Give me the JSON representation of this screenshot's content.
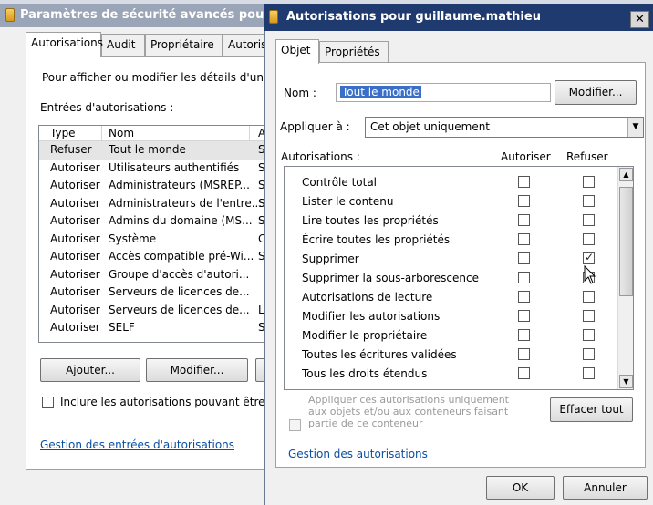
{
  "back_window": {
    "title": "Paramètres de sécurité avancés pour",
    "tabs": [
      "Autorisations",
      "Audit",
      "Propriétaire",
      "Autorisa"
    ],
    "intro": "Pour afficher ou modifier les détails d'une au",
    "entries_label": "Entrées d'autorisations :",
    "columns": [
      "Type",
      "Nom",
      "A"
    ],
    "rows": [
      {
        "type": "Refuser",
        "name": "Tout le monde",
        "extra": "S"
      },
      {
        "type": "Autoriser",
        "name": "Utilisateurs authentifiés",
        "extra": "S"
      },
      {
        "type": "Autoriser",
        "name": "Administrateurs (MSREP...",
        "extra": "S"
      },
      {
        "type": "Autoriser",
        "name": "Administrateurs de l'entre...",
        "extra": "S"
      },
      {
        "type": "Autoriser",
        "name": "Admins du domaine (MS...",
        "extra": "S"
      },
      {
        "type": "Autoriser",
        "name": "Système",
        "extra": "C"
      },
      {
        "type": "Autoriser",
        "name": "Accès compatible pré-Wi...",
        "extra": "S"
      },
      {
        "type": "Autoriser",
        "name": "Groupe d'accès d'autori...",
        "extra": ""
      },
      {
        "type": "Autoriser",
        "name": "Serveurs de licences de...",
        "extra": ""
      },
      {
        "type": "Autoriser",
        "name": "Serveurs de licences de...",
        "extra": "L"
      },
      {
        "type": "Autoriser",
        "name": "SELF",
        "extra": "S"
      }
    ],
    "add_button": "Ajouter...",
    "modify_button": "Modifier...",
    "include_label": "Inclure les autorisations pouvant être hé",
    "manage_link": "Gestion des entrées d'autorisations"
  },
  "dialog": {
    "title": "Autorisations pour guillaume.mathieu",
    "close": "✕",
    "tabs": [
      "Objet",
      "Propriétés"
    ],
    "name_label": "Nom :",
    "name_value": "Tout le monde",
    "modify_button": "Modifier...",
    "apply_label": "Appliquer à :",
    "apply_value": "Cet objet uniquement",
    "permissions_label": "Autorisations :",
    "allow_header": "Autoriser",
    "deny_header": "Refuser",
    "permissions": [
      {
        "label": "Contrôle total",
        "allow": false,
        "deny": false
      },
      {
        "label": "Lister le contenu",
        "allow": false,
        "deny": false
      },
      {
        "label": "Lire toutes les propriétés",
        "allow": false,
        "deny": false
      },
      {
        "label": "Écrire toutes les propriétés",
        "allow": false,
        "deny": false
      },
      {
        "label": "Supprimer",
        "allow": false,
        "deny": true
      },
      {
        "label": "Supprimer la sous-arborescence",
        "allow": false,
        "deny": false
      },
      {
        "label": "Autorisations de lecture",
        "allow": false,
        "deny": false
      },
      {
        "label": "Modifier les autorisations",
        "allow": false,
        "deny": false
      },
      {
        "label": "Modifier le propriétaire",
        "allow": false,
        "deny": false
      },
      {
        "label": "Toutes les écritures validées",
        "allow": false,
        "deny": false
      },
      {
        "label": "Tous les droits étendus",
        "allow": false,
        "deny": false
      }
    ],
    "apply_only_line1": "Appliquer ces autorisations uniquement",
    "apply_only_line2": "aux objets et/ou aux conteneurs faisant",
    "apply_only_line3": "partie de ce conteneur",
    "clear_all_button": "Effacer tout",
    "manage_link": "Gestion des autorisations",
    "ok_button": "OK",
    "cancel_button": "Annuler"
  }
}
